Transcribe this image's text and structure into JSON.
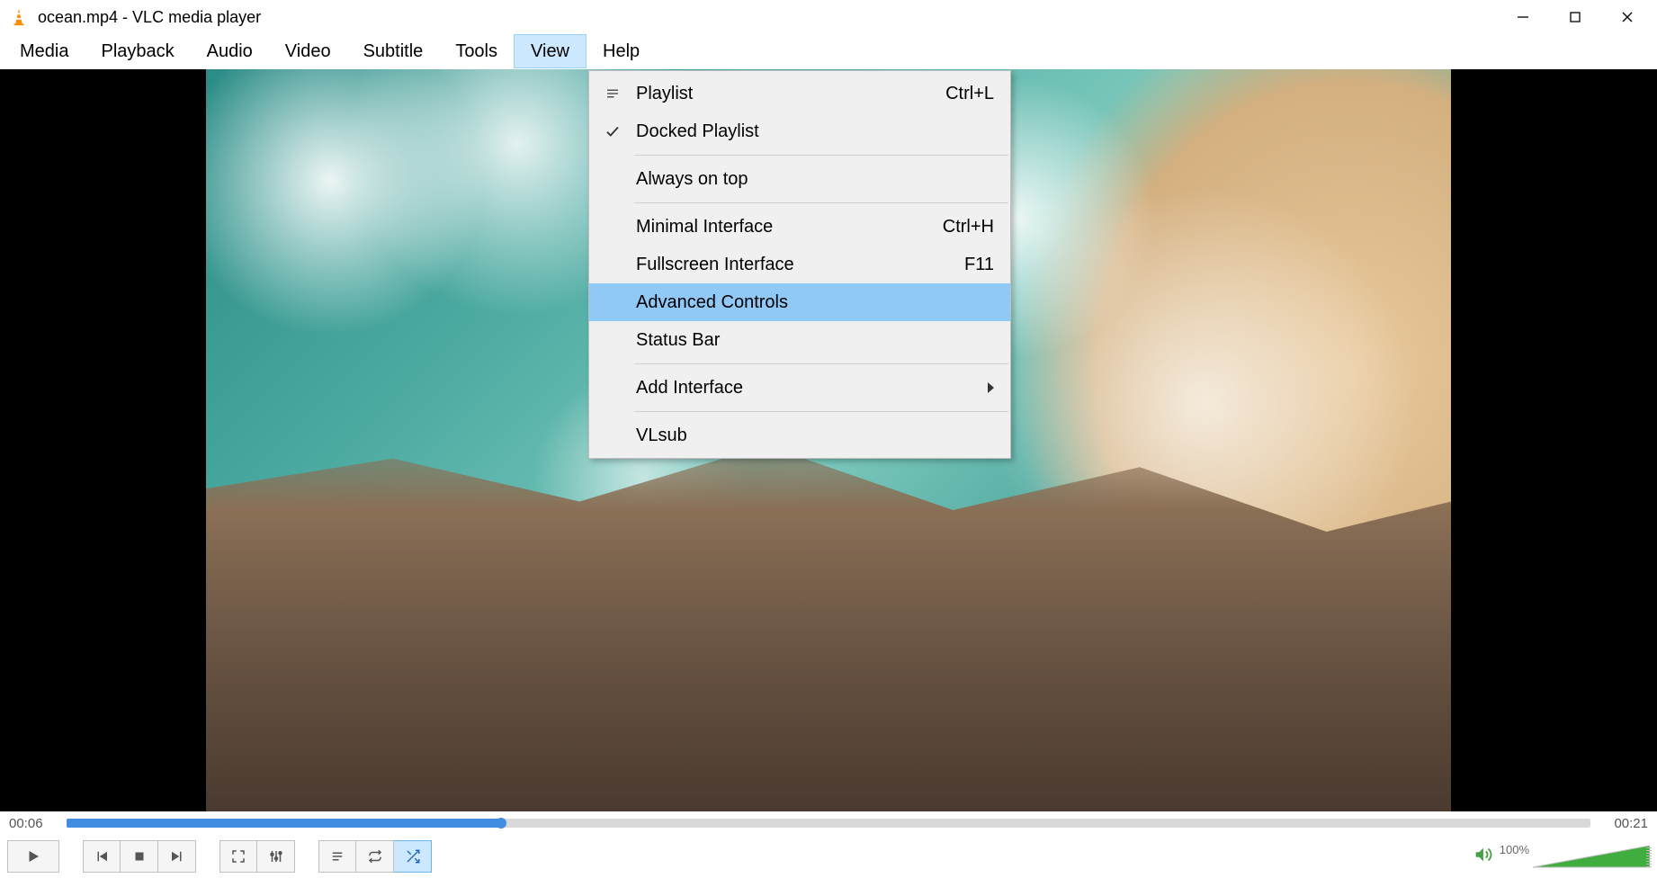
{
  "titlebar": {
    "title": "ocean.mp4 - VLC media player"
  },
  "menubar": {
    "items": [
      {
        "label": "Media"
      },
      {
        "label": "Playback"
      },
      {
        "label": "Audio"
      },
      {
        "label": "Video"
      },
      {
        "label": "Subtitle"
      },
      {
        "label": "Tools"
      },
      {
        "label": "View",
        "active": true
      },
      {
        "label": "Help"
      }
    ]
  },
  "view_menu": {
    "items": [
      {
        "label": "Playlist",
        "shortcut": "Ctrl+L",
        "icon": "playlist"
      },
      {
        "label": "Docked Playlist",
        "checked": true
      },
      {
        "sep": true
      },
      {
        "label": "Always on top"
      },
      {
        "sep": true
      },
      {
        "label": "Minimal Interface",
        "shortcut": "Ctrl+H"
      },
      {
        "label": "Fullscreen Interface",
        "shortcut": "F11"
      },
      {
        "label": "Advanced Controls",
        "highlight": true
      },
      {
        "label": "Status Bar"
      },
      {
        "sep": true
      },
      {
        "label": "Add Interface",
        "submenu": true
      },
      {
        "sep": true
      },
      {
        "label": "VLsub"
      }
    ]
  },
  "seek": {
    "elapsed": "00:06",
    "total": "00:21",
    "progress_percent": 28.5
  },
  "controls": {
    "play": "Play",
    "prev": "Previous",
    "stop": "Stop",
    "next": "Next",
    "fullscreen": "Fullscreen",
    "ext_settings": "Extended settings",
    "playlist": "Playlist",
    "loop": "Loop",
    "shuffle": "Random",
    "volume_label": "100%",
    "volume_percent": 100
  }
}
